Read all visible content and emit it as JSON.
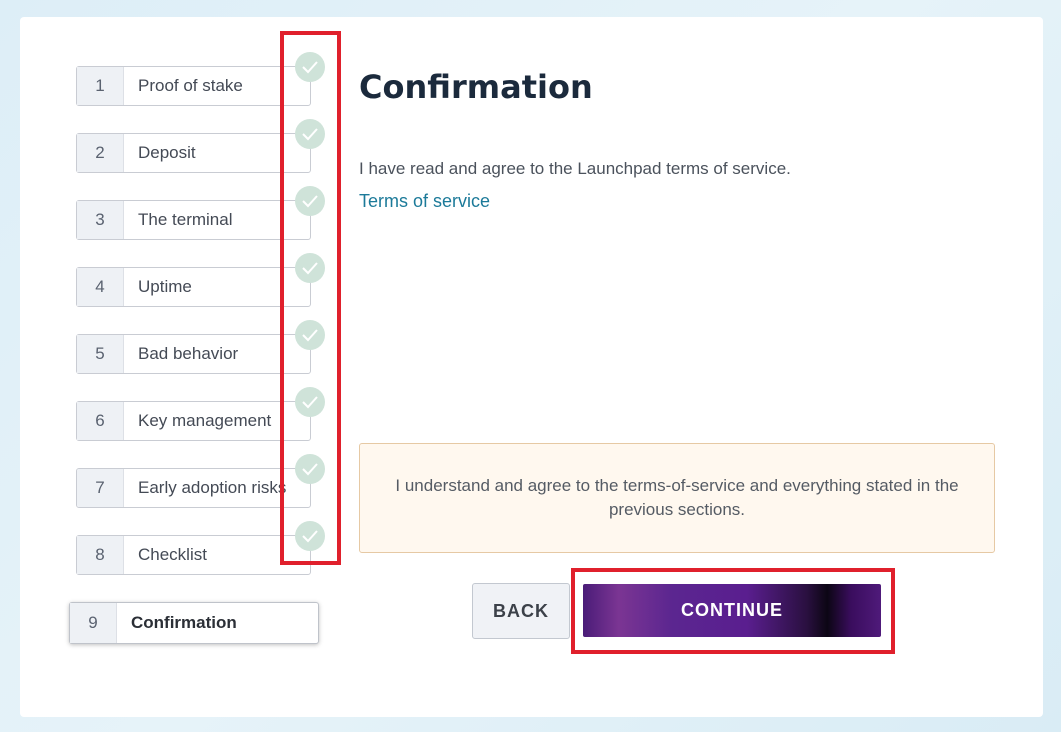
{
  "steps": [
    {
      "num": "1",
      "label": "Proof of stake",
      "done": true
    },
    {
      "num": "2",
      "label": "Deposit",
      "done": true
    },
    {
      "num": "3",
      "label": "The terminal",
      "done": true
    },
    {
      "num": "4",
      "label": "Uptime",
      "done": true
    },
    {
      "num": "5",
      "label": "Bad behavior",
      "done": true
    },
    {
      "num": "6",
      "label": "Key management",
      "done": true
    },
    {
      "num": "7",
      "label": "Early adoption risks",
      "done": true
    },
    {
      "num": "8",
      "label": "Checklist",
      "done": true
    },
    {
      "num": "9",
      "label": "Confirmation",
      "done": false,
      "active": true
    }
  ],
  "main": {
    "title": "Confirmation",
    "agree_text": "I have read and agree to the Launchpad terms of service.",
    "tos_link": "Terms of service",
    "notice": "I understand and agree to the terms-of-service and everything stated in the previous sections."
  },
  "buttons": {
    "back": "BACK",
    "continue": "CONTINUE"
  },
  "colors": {
    "highlight": "#e0202c",
    "link": "#1c7a99",
    "check_badge": "#cfe3d9"
  },
  "icons": {
    "check": "checkmark-icon"
  }
}
